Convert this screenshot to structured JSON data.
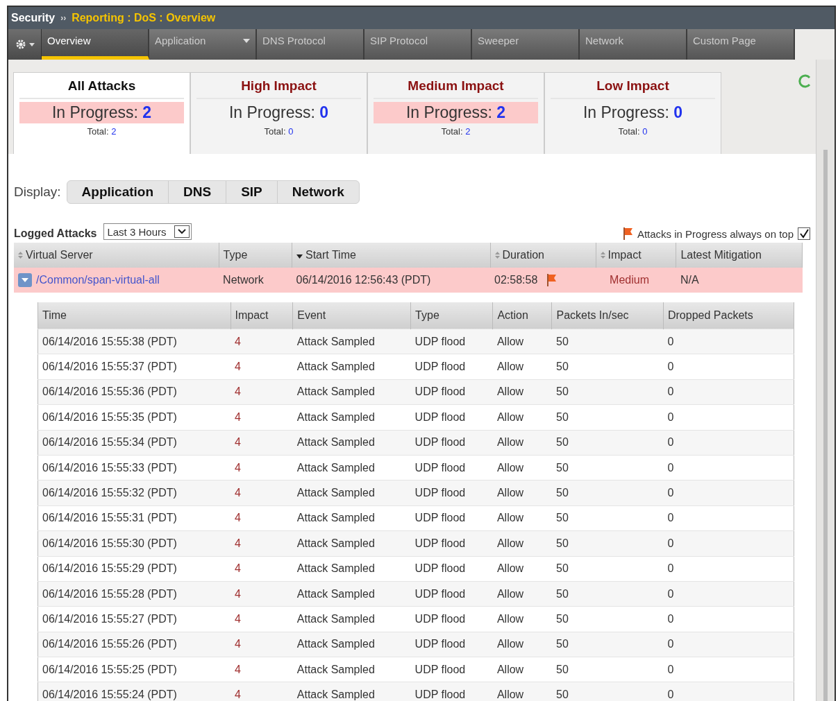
{
  "breadcrumb": {
    "section": "Security",
    "separator": "››",
    "path": "Reporting : DoS : Overview"
  },
  "nav_tabs": [
    {
      "label": "Overview",
      "selected": true,
      "has_menu": false
    },
    {
      "label": "Application",
      "selected": false,
      "has_menu": true
    },
    {
      "label": "DNS Protocol",
      "selected": false,
      "has_menu": false
    },
    {
      "label": "SIP Protocol",
      "selected": false,
      "has_menu": false
    },
    {
      "label": "Sweeper",
      "selected": false,
      "has_menu": false
    },
    {
      "label": "Network",
      "selected": false,
      "has_menu": false
    },
    {
      "label": "Custom Page",
      "selected": false,
      "has_menu": false
    }
  ],
  "summary_cards": [
    {
      "title": "All Attacks",
      "selected": true,
      "highlighted": true,
      "kind": "all",
      "in_progress_label": "In Progress:",
      "in_progress": "2",
      "total_label": "Total:",
      "total": "2"
    },
    {
      "title": "High Impact",
      "selected": false,
      "highlighted": false,
      "kind": "impact",
      "in_progress_label": "In Progress:",
      "in_progress": "0",
      "total_label": "Total:",
      "total": "0"
    },
    {
      "title": "Medium Impact",
      "selected": false,
      "highlighted": true,
      "kind": "impact",
      "in_progress_label": "In Progress:",
      "in_progress": "2",
      "total_label": "Total:",
      "total": "2"
    },
    {
      "title": "Low Impact",
      "selected": false,
      "highlighted": false,
      "kind": "impact",
      "in_progress_label": "In Progress:",
      "in_progress": "0",
      "total_label": "Total:",
      "total": "0"
    }
  ],
  "display": {
    "label": "Display:",
    "options": [
      {
        "label": "Application",
        "selected": false
      },
      {
        "label": "DNS",
        "selected": false
      },
      {
        "label": "SIP",
        "selected": false
      },
      {
        "label": "Network",
        "selected": false
      }
    ]
  },
  "logged_attacks": {
    "label": "Logged Attacks",
    "range": "Last 3 Hours"
  },
  "on_top": {
    "label": "Attacks in Progress always on top",
    "checked": true
  },
  "attacks_table": {
    "columns": [
      {
        "label": "Virtual Server",
        "sortable": true,
        "sorted_desc": false
      },
      {
        "label": "Type",
        "sortable": false,
        "sorted_desc": false
      },
      {
        "label": "Start Time",
        "sortable": true,
        "sorted_desc": true
      },
      {
        "label": "Duration",
        "sortable": true,
        "sorted_desc": false
      },
      {
        "label": "Impact",
        "sortable": true,
        "sorted_desc": false
      },
      {
        "label": "Latest Mitigation",
        "sortable": false,
        "sorted_desc": false
      }
    ],
    "rows": [
      {
        "virtual_server": "/Common/span-virtual-all",
        "type": "Network",
        "start_time": "06/14/2016 12:56:43 (PDT)",
        "duration": "02:58:58",
        "in_progress": true,
        "impact": "Medium",
        "mitigation": "N/A",
        "expanded": true
      }
    ]
  },
  "events_table": {
    "columns": [
      "Time",
      "Impact",
      "Event",
      "Type",
      "Action",
      "Packets In/sec",
      "Dropped Packets"
    ],
    "rows": [
      [
        "06/14/2016 15:55:38 (PDT)",
        "4",
        "Attack Sampled",
        "UDP flood",
        "Allow",
        "50",
        "0"
      ],
      [
        "06/14/2016 15:55:37 (PDT)",
        "4",
        "Attack Sampled",
        "UDP flood",
        "Allow",
        "50",
        "0"
      ],
      [
        "06/14/2016 15:55:36 (PDT)",
        "4",
        "Attack Sampled",
        "UDP flood",
        "Allow",
        "50",
        "0"
      ],
      [
        "06/14/2016 15:55:35 (PDT)",
        "4",
        "Attack Sampled",
        "UDP flood",
        "Allow",
        "50",
        "0"
      ],
      [
        "06/14/2016 15:55:34 (PDT)",
        "4",
        "Attack Sampled",
        "UDP flood",
        "Allow",
        "50",
        "0"
      ],
      [
        "06/14/2016 15:55:33 (PDT)",
        "4",
        "Attack Sampled",
        "UDP flood",
        "Allow",
        "50",
        "0"
      ],
      [
        "06/14/2016 15:55:32 (PDT)",
        "4",
        "Attack Sampled",
        "UDP flood",
        "Allow",
        "50",
        "0"
      ],
      [
        "06/14/2016 15:55:31 (PDT)",
        "4",
        "Attack Sampled",
        "UDP flood",
        "Allow",
        "50",
        "0"
      ],
      [
        "06/14/2016 15:55:30 (PDT)",
        "4",
        "Attack Sampled",
        "UDP flood",
        "Allow",
        "50",
        "0"
      ],
      [
        "06/14/2016 15:55:29 (PDT)",
        "4",
        "Attack Sampled",
        "UDP flood",
        "Allow",
        "50",
        "0"
      ],
      [
        "06/14/2016 15:55:28 (PDT)",
        "4",
        "Attack Sampled",
        "UDP flood",
        "Allow",
        "50",
        "0"
      ],
      [
        "06/14/2016 15:55:27 (PDT)",
        "4",
        "Attack Sampled",
        "UDP flood",
        "Allow",
        "50",
        "0"
      ],
      [
        "06/14/2016 15:55:26 (PDT)",
        "4",
        "Attack Sampled",
        "UDP flood",
        "Allow",
        "50",
        "0"
      ],
      [
        "06/14/2016 15:55:25 (PDT)",
        "4",
        "Attack Sampled",
        "UDP flood",
        "Allow",
        "50",
        "0"
      ],
      [
        "06/14/2016 15:55:24 (PDT)",
        "4",
        "Attack Sampled",
        "UDP flood",
        "Allow",
        "50",
        "0"
      ]
    ]
  }
}
